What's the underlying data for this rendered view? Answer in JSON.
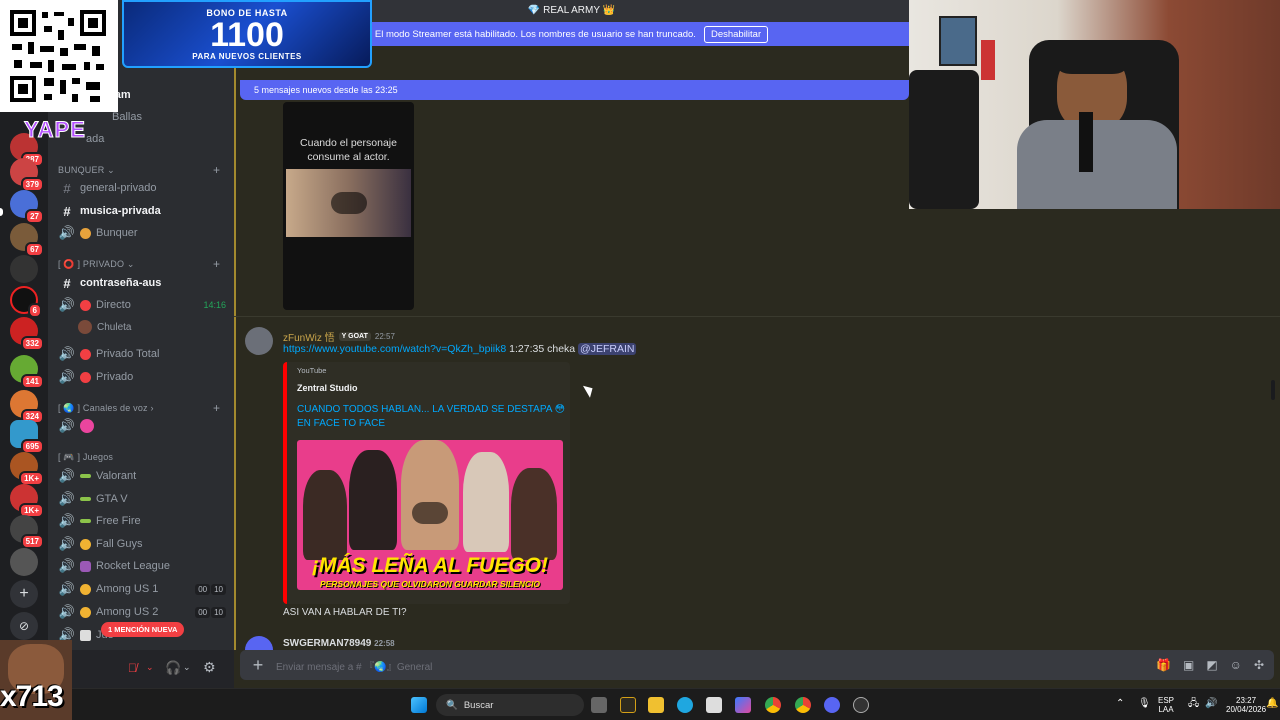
{
  "topbar": {
    "server_name": "REAL ARMY",
    "streamer_text": "El modo Streamer está habilitado. Los nombres de usuario se han truncado.",
    "disable_button": "Deshabilitar"
  },
  "overlays": {
    "bono_line1": "BONO DE HASTA",
    "bono_line2": "1100",
    "bono_line3": "PARA NUEVOS CLIENTES",
    "yape": "YAPE",
    "x713": "x713"
  },
  "servers": [
    {
      "badge": "387"
    },
    {
      "badge": "379"
    },
    {
      "badge": "27"
    },
    {
      "badge": "67"
    },
    {
      "badge": ""
    },
    {
      "badge": "6"
    },
    {
      "badge": "332"
    },
    {
      "badge": "141"
    },
    {
      "badge": "324"
    },
    {
      "badge": "695"
    },
    {
      "badge": "1K+"
    },
    {
      "badge": "1K+"
    },
    {
      "badge": "517"
    },
    {
      "badge": ""
    }
  ],
  "sidebar": {
    "partial1": "pam",
    "partial2": "Ballas",
    "partial3": "ada",
    "cat_bunquer": "BUNQUER",
    "ch_general_privado": "general-privado",
    "ch_musica_privada": "musica-privada",
    "ch_bunquer": "Bunquer",
    "cat_privado": "[ ⭕ ] PRIVADO",
    "ch_contrasena": "contraseña-aus",
    "ch_directo": "Directo",
    "ch_directo_time": "14:16",
    "ch_chuleta": "Chuleta",
    "ch_privado_total": "Privado Total",
    "ch_privado": "Privado",
    "cat_voz": "[ 🌏 ] Canales de voz",
    "cat_juegos": "[ 🎮 ] Juegos",
    "ch_valorant": "Valorant",
    "ch_gtav": "GTA V",
    "ch_freefire": "Free Fire",
    "ch_fallguys": "Fall Guys",
    "ch_rocket": "Rocket League",
    "ch_among1": "Among US 1",
    "ch_among2": "Among US 2",
    "ch_jue": "Jue",
    "cnt_a": "00",
    "cnt_b": "10",
    "mention_badge": "1 MENCIÓN NUEVA"
  },
  "chat": {
    "new_messages": "5 mensajes nuevos desde las 23:25",
    "video_caption_1": "Cuando el personaje",
    "video_caption_2": "consume al actor.",
    "msg1": {
      "username": "zFunWiz 悟",
      "tag": "GOAT",
      "time": "22:57",
      "link": "https://www.youtube.com/watch?v=QkZh_bpiik8",
      "text": " 1:27:35 cheka ",
      "mention": "@JEFRAIN"
    },
    "embed": {
      "provider": "YouTube",
      "author": "Zentral Studio",
      "title": "CUANDO TODOS HABLAN... LA VERDAD SE DESTAPA 😳 EN FACE TO FACE",
      "thumb_big": "¡MÁS LEÑA AL FUEGO!",
      "thumb_small": "PERSONAJES QUE OLVIDARON GUARDAR SILENCIO"
    },
    "msg2": "ASI VAN A HABLAR DE TI?",
    "msg3_name": "SWGERMAN78949",
    "msg3_time": "22:58"
  },
  "input": {
    "placeholder": "Enviar mensaje a # 『🌏』General"
  },
  "taskbar": {
    "search": "Buscar",
    "lang1": "ESP",
    "lang2": "LAA",
    "time": "23:27",
    "date": "20/04/2026"
  }
}
